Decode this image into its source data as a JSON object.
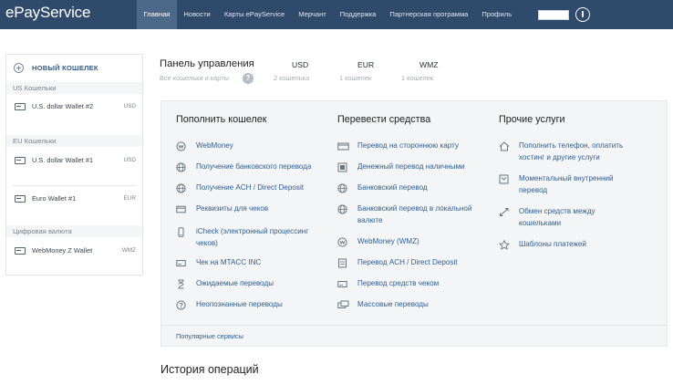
{
  "app": {
    "logo": "ePayService"
  },
  "nav": {
    "items": [
      {
        "label": "Главная",
        "active": true
      },
      {
        "label": "Новости",
        "active": false
      },
      {
        "label": "Карты ePayService",
        "active": false
      },
      {
        "label": "Мерчант",
        "active": false
      },
      {
        "label": "Поддержка",
        "active": false
      },
      {
        "label": "Партнерская программа",
        "active": false
      },
      {
        "label": "Профиль",
        "active": false
      }
    ],
    "search_value": ""
  },
  "sidebar": {
    "new_wallet_label": "НОВЫЙ КОШЕЛЕК",
    "groups": [
      {
        "title": "US Кошельки",
        "wallets": [
          {
            "name": "U.S. dollar Wallet #2",
            "currency": "USD"
          }
        ]
      },
      {
        "title": "EU Кошельки",
        "wallets": [
          {
            "name": "U.S. dollar Wallet #1",
            "currency": "USD"
          },
          {
            "name": "Euro Wallet #1",
            "currency": "EUR"
          }
        ]
      },
      {
        "title": "Цифровая валюта",
        "wallets": [
          {
            "name": "WebMoney Z Wallet",
            "currency": "WMZ"
          }
        ]
      }
    ]
  },
  "dashboard": {
    "title": "Панель управления",
    "subtitle": "Все кошельки и карты",
    "help_glyph": "?",
    "currencies": [
      {
        "code": "USD",
        "sub": "2 кошелька"
      },
      {
        "code": "EUR",
        "sub": "1 кошелек"
      },
      {
        "code": "WMZ",
        "sub": "1 кошелек"
      }
    ]
  },
  "services": {
    "columns": [
      {
        "title": "Пополнить кошелек",
        "items": [
          {
            "icon": "webmoney-icon",
            "lines": [
              "WebMoney"
            ]
          },
          {
            "icon": "globe-icon",
            "lines": [
              "Получение банковского перевода"
            ]
          },
          {
            "icon": "globe-icon",
            "lines": [
              "Получение ACH / Direct Deposit"
            ]
          },
          {
            "icon": "card-icon",
            "lines": [
              "Реквизиты для чеков"
            ]
          },
          {
            "icon": "icheck-icon",
            "lines": [
              "iCheck (электронный процессинг",
              "чеков)"
            ]
          },
          {
            "icon": "check-icon",
            "lines": [
              "Чек на MTACC INC"
            ]
          },
          {
            "icon": "hourglass-icon",
            "lines": [
              "Ожидаемые переводы"
            ]
          },
          {
            "icon": "question-icon",
            "lines": [
              "Неопознанные переводы"
            ]
          }
        ]
      },
      {
        "title": "Перевести средства",
        "items": [
          {
            "icon": "card-transfer-icon",
            "lines": [
              "Перевод на стороннюю карту"
            ]
          },
          {
            "icon": "cash-icon",
            "lines": [
              "Денежный перевод наличными"
            ]
          },
          {
            "icon": "globe-icon",
            "lines": [
              "Банковский перевод"
            ]
          },
          {
            "icon": "globe-icon",
            "lines": [
              "Банковский перевод в локальной",
              "валюте"
            ]
          },
          {
            "icon": "webmoney-icon",
            "lines": [
              "WebMoney (WMZ)"
            ]
          },
          {
            "icon": "document-icon",
            "lines": [
              "Перевод ACH / Direct Deposit"
            ]
          },
          {
            "icon": "check-icon",
            "lines": [
              "Перевод средств чеком"
            ]
          },
          {
            "icon": "bulk-icon",
            "lines": [
              "Массовые переводы"
            ]
          }
        ]
      },
      {
        "title": "Прочие услуги",
        "items": [
          {
            "icon": "home-icon",
            "lines": [
              "Пополнить телефон, оплатить",
              "хостинг и другие услуги"
            ]
          },
          {
            "icon": "internal-transfer-icon",
            "lines": [
              "Моментальный внутренний",
              "перевод"
            ]
          },
          {
            "icon": "exchange-icon",
            "lines": [
              "Обмен средств между",
              "кошельками"
            ]
          },
          {
            "icon": "star-icon",
            "lines": [
              "Шаблоны платежей"
            ]
          }
        ]
      }
    ],
    "footer_link": "Популярные сервисы"
  },
  "history": {
    "title": "История операций"
  },
  "colors": {
    "topbar": "#2f4a6b",
    "active_tab": "#4d6889",
    "link": "#2f5d8f",
    "panel_bg": "#f3f5f7"
  }
}
